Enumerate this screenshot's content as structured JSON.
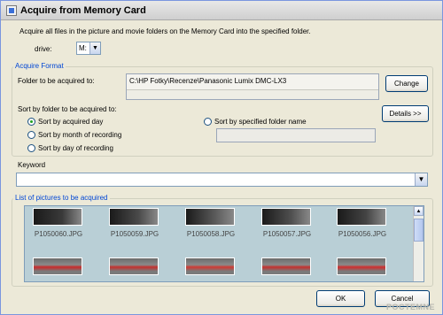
{
  "window": {
    "title": "Acquire from Memory Card"
  },
  "description": "Acquire all files in the picture and movie folders on the Memory Card into the specified folder.",
  "drive": {
    "label": "drive:",
    "value": "M:"
  },
  "acquire_format": {
    "group_label": "Acquire Format",
    "folder_label": "Folder to be acquired to:",
    "folder_path": "C:\\HP Fotky\\Recenze\\Panasonic Lumix DMC-LX3",
    "change_button": "Change",
    "sort_label": "Sort by folder to be acquired to:",
    "details_button": "Details >>",
    "sort_options": [
      {
        "label": "Sort by acquired day",
        "selected": true
      },
      {
        "label": "Sort by month of recording",
        "selected": false
      },
      {
        "label": "Sort by day of recording",
        "selected": false
      },
      {
        "label": "Sort by specified folder name",
        "selected": false
      }
    ]
  },
  "keyword": {
    "label": "Keyword",
    "value": ""
  },
  "pictures": {
    "group_label": "List of pictures to be acquired",
    "items": [
      {
        "filename": "P1050060.JPG",
        "color": "#3a3a3a"
      },
      {
        "filename": "P1050059.JPG",
        "color": "#4a4a4a"
      },
      {
        "filename": "P1050058.JPG",
        "color": "#5a5a5a"
      },
      {
        "filename": "P1050057.JPG",
        "color": "#4f4f4f"
      },
      {
        "filename": "P1050056.JPG",
        "color": "#444444"
      },
      {
        "filename": "",
        "color": "#c92a2a"
      },
      {
        "filename": "",
        "color": "#c4302d"
      },
      {
        "filename": "",
        "color": "#cf3a32"
      },
      {
        "filename": "",
        "color": "#c4302d"
      },
      {
        "filename": "",
        "color": "#cf2d2d"
      }
    ]
  },
  "buttons": {
    "ok": "OK",
    "cancel": "Cancel"
  },
  "watermark": "POCTEMNE"
}
